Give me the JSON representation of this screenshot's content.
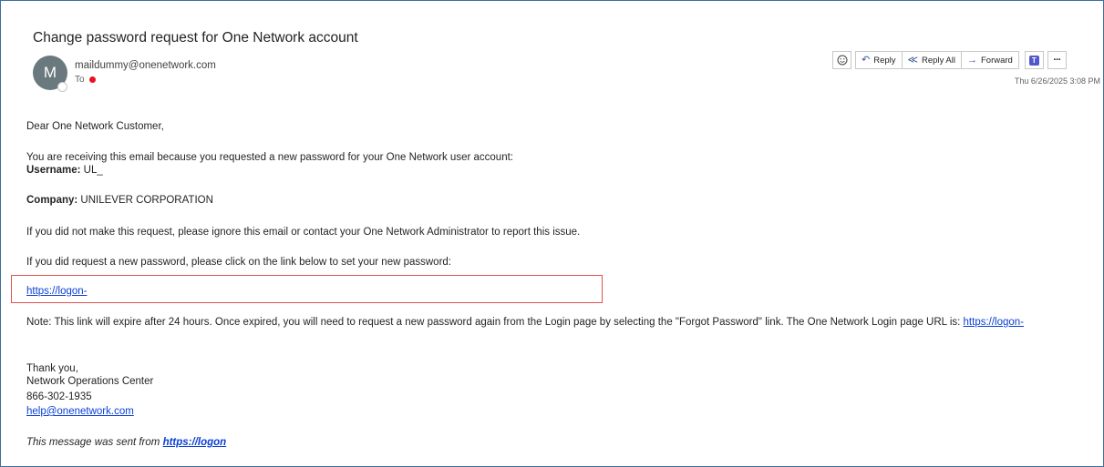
{
  "email": {
    "subject": "Change password request for One Network account",
    "avatar_initial": "M",
    "sender": "maildummy@onenetwork.com",
    "to_label": "To",
    "timestamp": "Thu 6/26/2025 3:08 PM"
  },
  "toolbar": {
    "emoji_icon": "smiley-icon",
    "reply_label": "Reply",
    "reply_all_label": "Reply All",
    "forward_label": "Forward",
    "teams_icon": "teams-icon",
    "more_label": "···"
  },
  "body": {
    "greeting": "Dear One Network Customer,",
    "intro": "You are receiving this email because you requested a new password for your One Network user account:",
    "username_label": "Username:",
    "username_value": " UL_",
    "company_label": "Company:",
    "company_value": " UNILEVER CORPORATION",
    "ignore_text": "If you did not make this request, please ignore this email or contact your One Network Administrator to report this issue.",
    "click_text": "If you did request a new password, please click on the link below to set your new password:",
    "reset_link": "https://logon-",
    "note_text": "Note: This link will expire after 24 hours. Once expired, you will need to request a new password again from the Login page by selecting the \"Forgot Password\" link. The One Network Login page URL is: ",
    "note_link": "https://logon-",
    "thanks": "Thank you,",
    "team": "Network Operations Center",
    "phone": "866-302-1935",
    "help_email": "help@onenetwork.com",
    "sent_from_text": "This message was sent from ",
    "sent_from_link": "https://logon "
  },
  "colors": {
    "highlight_border": "#e0524f",
    "presence_dot": "#e81123",
    "link": "#0b3fd6"
  }
}
